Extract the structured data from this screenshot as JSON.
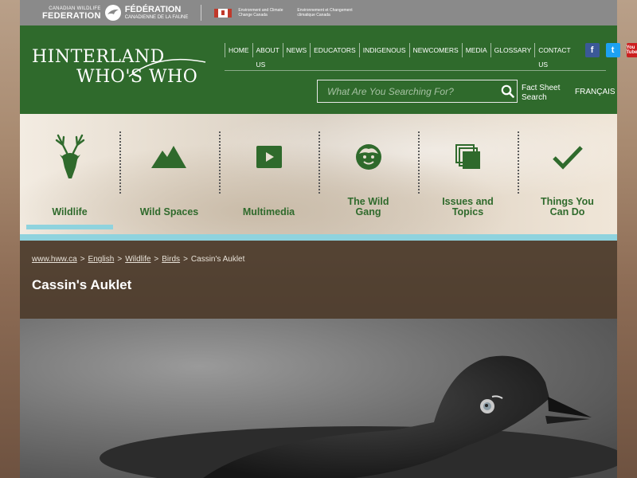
{
  "topbar": {
    "federation_en_small": "CANADIAN WILDLIFE",
    "federation_en_big": "FEDERATION",
    "federation_fr_big": "FÉDÉRATION",
    "federation_fr_small": "CANADIENNE DE LA FAUNE",
    "eccc_en": "Environment and Climate Change Canada",
    "eccc_fr": "Environnement et Changement climatique Canada"
  },
  "header": {
    "logo_line1": "HINTERLAND",
    "logo_line2": "WHO'S WHO",
    "nav": [
      "HOME",
      "ABOUT US",
      "NEWS",
      "EDUCATORS",
      "INDIGENOUS",
      "NEWCOMERS",
      "MEDIA",
      "GLOSSARY",
      "CONTACT US"
    ],
    "social": {
      "facebook": "f",
      "twitter": "t",
      "youtube": "You Tube"
    },
    "search_placeholder": "What Are You Searching For?",
    "fact_sheet_search": "Fact Sheet Search",
    "francais": "FRANÇAIS"
  },
  "categories": [
    {
      "label": "Wildlife",
      "icon": "deer-icon",
      "active": true
    },
    {
      "label": "Wild Spaces",
      "icon": "mountain-icon",
      "active": false
    },
    {
      "label": "Multimedia",
      "icon": "play-icon",
      "active": false
    },
    {
      "label": "The Wild Gang",
      "icon": "face-icon",
      "active": false
    },
    {
      "label": "Issues and Topics",
      "icon": "stack-icon",
      "active": false
    },
    {
      "label": "Things You Can Do",
      "icon": "checkmark-icon",
      "active": false
    }
  ],
  "breadcrumb": {
    "items": [
      "www.hww.ca",
      "English",
      "Wildlife",
      "Birds"
    ],
    "current": "Cassin's Auklet",
    "sep": ">"
  },
  "page_title": "Cassin's Auklet",
  "colors": {
    "brand_green": "#2f6a2c",
    "accent_teal": "#8fd3de",
    "topbar_gray": "#8a8a8a"
  }
}
